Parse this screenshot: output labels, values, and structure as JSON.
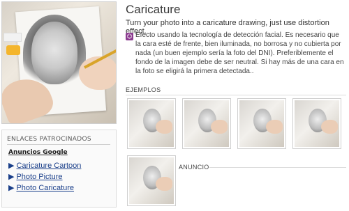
{
  "header": {
    "title": "Caricature",
    "subtitle": "Turn your photo into a caricature drawing, just use distortion effect.",
    "description": "Efecto usando la tecnología de detección facial. Es necesario que la cara esté de frente, bien iluminada, no borrosa y no cubierta por nada (un buen ejemplo sería la foto del DNI). Preferiblemente el fondo de la imagen debe de ser neutral. Si hay más de una cara en la foto se eligirá la primera detectada.."
  },
  "examples": {
    "label": "EJEMPLOS",
    "count": 5
  },
  "anuncio": {
    "label": "ANUNCIO"
  },
  "sponsored": {
    "header": "ENLACES PATROCINADOS",
    "ads_label": "Anuncios Google",
    "links": [
      {
        "arrow": "▶",
        "label": "Caricature Cartoon"
      },
      {
        "arrow": "▶",
        "label": "Photo Picture"
      },
      {
        "arrow": "▶",
        "label": "Photo Caricature"
      }
    ]
  },
  "icons": {
    "description_icon": "face-detection-icon",
    "link_bullet": "triangle-right-icon"
  },
  "colors": {
    "link": "#1a3f8a",
    "icon_accent": "#8b3b8f",
    "border": "#cfcfcf"
  }
}
